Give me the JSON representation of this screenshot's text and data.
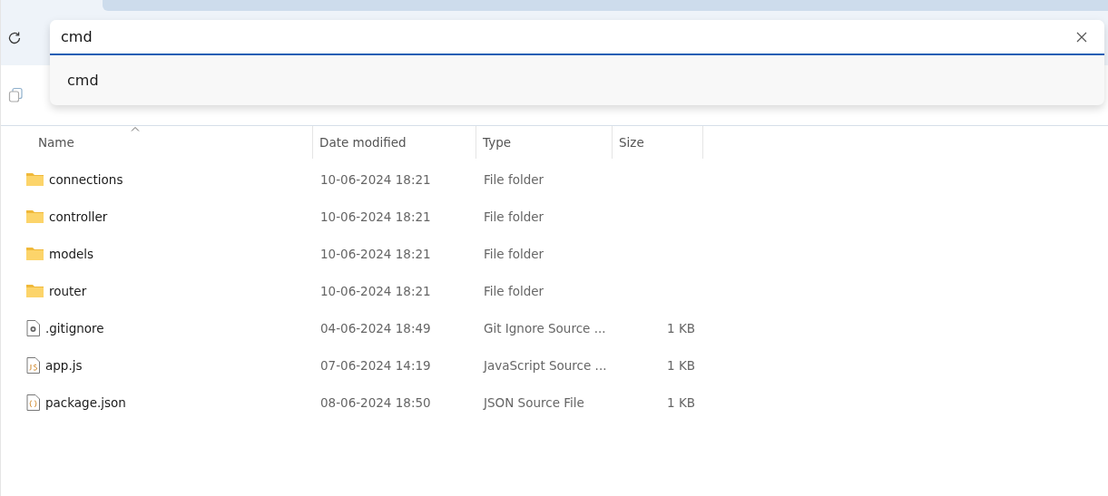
{
  "address_bar": {
    "value": "cmd"
  },
  "suggestions": [
    {
      "label": "cmd"
    }
  ],
  "table": {
    "columns": [
      {
        "label": "Name",
        "sorted": true
      },
      {
        "label": "Date modified",
        "sorted": false
      },
      {
        "label": "Type",
        "sorted": false
      },
      {
        "label": "Size",
        "sorted": false
      }
    ],
    "rows": [
      {
        "kind": "folder",
        "name": "connections",
        "date": "10-06-2024 18:21",
        "type": "File folder"
      },
      {
        "kind": "folder",
        "name": "controller",
        "date": "10-06-2024 18:21",
        "type": "File folder"
      },
      {
        "kind": "folder",
        "name": "models",
        "date": "10-06-2024 18:21",
        "type": "File folder"
      },
      {
        "kind": "folder",
        "name": "router",
        "date": "10-06-2024 18:21",
        "type": "File folder"
      },
      {
        "kind": "settings",
        "name": ".gitignore",
        "date": "04-06-2024 18:49",
        "type": "Git Ignore Source ...",
        "size": "1 KB"
      },
      {
        "kind": "js",
        "name": "app.js",
        "date": "07-06-2024 14:19",
        "type": "JavaScript Source ...",
        "size": "1 KB"
      },
      {
        "kind": "json",
        "name": "package.json",
        "date": "08-06-2024 18:50",
        "type": "JSON Source File",
        "size": "1 KB"
      }
    ]
  }
}
